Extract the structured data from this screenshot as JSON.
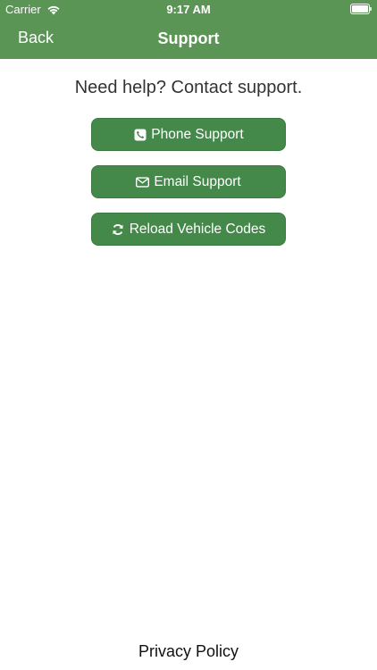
{
  "status_bar": {
    "carrier": "Carrier",
    "time": "9:17 AM"
  },
  "nav": {
    "back_label": "Back",
    "title": "Support"
  },
  "content": {
    "help_text": "Need help? Contact support.",
    "buttons": [
      {
        "label": "Phone Support",
        "icon": "phone-icon"
      },
      {
        "label": "Email Support",
        "icon": "envelope-icon"
      },
      {
        "label": "Reload Vehicle Codes",
        "icon": "refresh-icon"
      }
    ]
  },
  "footer": {
    "privacy_label": "Privacy Policy"
  },
  "colors": {
    "header": "#5b9556",
    "button": "#44894a"
  }
}
